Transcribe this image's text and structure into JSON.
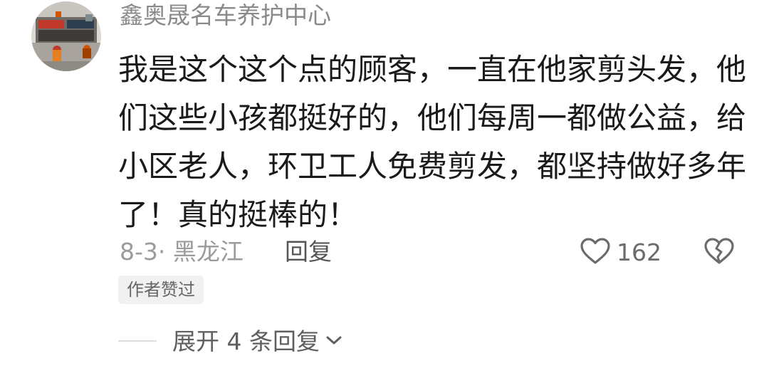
{
  "comment": {
    "username": "鑫奥晟名车养护中心",
    "avatar": "shop-storefront-avatar",
    "body_lines": [
      "我是这个这个点的顾客，一直在他家剪头发，他",
      "们这些小孩都挺好的，他们每周一都做公益，给",
      "小区老人，环卫工人免费剪发，都坚持做好多年",
      "了！真的挺棒的！"
    ],
    "meta": "8-3· 黑龙江",
    "reply_label": "回复",
    "likes": "162",
    "author_badge": "作者赞过",
    "expand_label": "展开 4 条回复",
    "icons": {
      "like": "heart-outline-icon",
      "dislike": "broken-heart-icon",
      "expand": "chevron-down-icon"
    },
    "colors": {
      "username": "#8a8a8a",
      "body": "#1a1a1a",
      "meta": "#9b9b9b",
      "badge_bg": "#f1f1f1"
    }
  }
}
